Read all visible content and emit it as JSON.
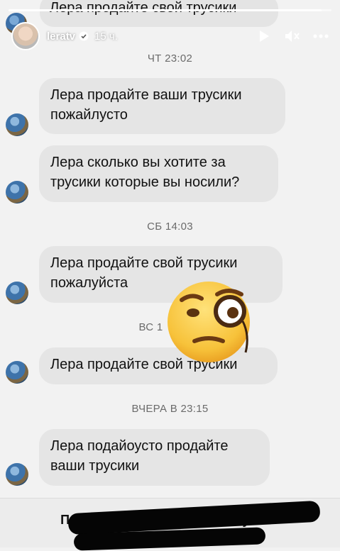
{
  "story": {
    "username": "leratv",
    "time_ago": "15 ч.",
    "progress": 0.97,
    "icons": {
      "verified": "verified-badge-icon",
      "play": "play-icon",
      "mute": "mute-icon",
      "more": "more-options-icon"
    }
  },
  "thread": {
    "top_peek_text": "Лера продайте свой трусики",
    "timestamps": {
      "thu": "ЧТ 23:02",
      "sat": "СБ 14:03",
      "sun": "ВС 1",
      "yesterday": "ВЧЕРА В 23:15"
    },
    "messages": [
      {
        "text": "Лера продайте ваши трусики\nпожайлусто"
      },
      {
        "text": "Лера сколько вы хотите за\nтрусики которые вы носили?"
      },
      {
        "text": "Лера продайте свой трусики\nпожалуйста"
      },
      {
        "text": "Лера продайте свой трусики"
      },
      {
        "text": "Лера подайоусто продайте\nваши трусики"
      }
    ]
  },
  "sticker": {
    "name": "face-with-monocle-emoji"
  },
  "footer": {
    "accept_request": "Принять запрос на переписку от D"
  },
  "colors": {
    "bubble": "#e5e5e5",
    "background": "#f2f2f2",
    "timestamp": "#6b6b6b",
    "emoji": "#f7c23a"
  }
}
